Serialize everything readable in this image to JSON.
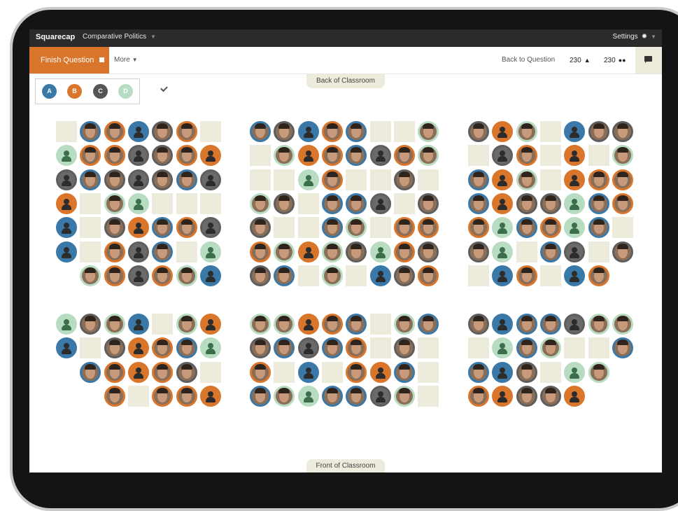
{
  "topbar": {
    "brand": "Squarecap",
    "course": "Comparative Politics",
    "settings_label": "Settings"
  },
  "toolbar": {
    "finish_label": "Finish Question",
    "more_label": "More",
    "back_label": "Back to Question",
    "count_responses": "230",
    "count_students": "230"
  },
  "classroom": {
    "back_label": "Back of Classroom",
    "front_label": "Front of Classroom"
  },
  "legend": [
    "A",
    "B",
    "C",
    "D"
  ],
  "colors": {
    "A": "#3a78a8",
    "B": "#d9762c",
    "C": "#5e5e5e",
    "D": "#b8dcc2",
    "empty": "#ecebdc"
  },
  "sections": [
    {
      "rows": [
        [
          "E",
          "A",
          "B",
          "A",
          "C",
          "B",
          "E"
        ],
        [
          "D",
          "B",
          "B",
          "C",
          "C",
          "B",
          "B"
        ],
        [
          "C",
          "A",
          "C",
          "C",
          "C",
          "A",
          "C"
        ],
        [
          "B",
          "E",
          "D",
          "D",
          "E",
          "E",
          "E"
        ],
        [
          "A",
          "E",
          "C",
          "B",
          "A",
          "B",
          "C"
        ],
        [
          "A",
          "E",
          "B",
          "C",
          "A",
          "E",
          "D"
        ],
        [
          "-",
          "D",
          "B",
          "C",
          "B",
          "D",
          "A"
        ]
      ]
    },
    {
      "rows": [
        [
          "A",
          "C",
          "A",
          "B",
          "A",
          "E",
          "E",
          "D"
        ],
        [
          "E",
          "D",
          "B",
          "B",
          "A",
          "C",
          "B",
          "D"
        ],
        [
          "E",
          "E",
          "D",
          "B",
          "E",
          "E",
          "C",
          "E"
        ],
        [
          "D",
          "C",
          "E",
          "A",
          "A",
          "C",
          "E",
          "C"
        ],
        [
          "C",
          "E",
          "E",
          "A",
          "D",
          "E",
          "B",
          "B"
        ],
        [
          "B",
          "D",
          "B",
          "D",
          "C",
          "D",
          "B",
          "C"
        ],
        [
          "C",
          "A",
          "E",
          "D",
          "E",
          "A",
          "C",
          "B"
        ]
      ]
    },
    {
      "rows": [
        [
          "C",
          "B",
          "D",
          "E",
          "A",
          "C",
          "C"
        ],
        [
          "E",
          "C",
          "B",
          "E",
          "B",
          "E",
          "D"
        ],
        [
          "A",
          "B",
          "D",
          "E",
          "B",
          "B",
          "B"
        ],
        [
          "A",
          "B",
          "C",
          "C",
          "D",
          "A",
          "B"
        ],
        [
          "B",
          "D",
          "A",
          "B",
          "D",
          "A",
          "E"
        ],
        [
          "C",
          "D",
          "E",
          "A",
          "C",
          "E",
          "C"
        ],
        [
          "E",
          "A",
          "B",
          "E",
          "A",
          "B",
          "-"
        ]
      ]
    },
    {
      "rows": [
        [
          "D",
          "C",
          "D",
          "A",
          "E",
          "D",
          "B"
        ],
        [
          "A",
          "E",
          "C",
          "B",
          "B",
          "A",
          "D"
        ],
        [
          "-",
          "A",
          "B",
          "B",
          "B",
          "C",
          "E"
        ],
        [
          "-",
          "-",
          "B",
          "E",
          "B",
          "B",
          "B"
        ]
      ]
    },
    {
      "rows": [
        [
          "D",
          "D",
          "B",
          "B",
          "A",
          "E",
          "D",
          "A"
        ],
        [
          "C",
          "A",
          "C",
          "A",
          "B",
          "E",
          "C",
          "E"
        ],
        [
          "B",
          "E",
          "A",
          "E",
          "B",
          "B",
          "A",
          "E"
        ],
        [
          "A",
          "D",
          "D",
          "A",
          "A",
          "C",
          "D",
          "E"
        ]
      ]
    },
    {
      "rows": [
        [
          "C",
          "A",
          "A",
          "A",
          "C",
          "D",
          "D"
        ],
        [
          "E",
          "D",
          "A",
          "D",
          "E",
          "E",
          "A"
        ],
        [
          "A",
          "A",
          "C",
          "E",
          "D",
          "D",
          "-"
        ],
        [
          "B",
          "B",
          "C",
          "C",
          "B",
          "-",
          "-"
        ]
      ]
    }
  ]
}
